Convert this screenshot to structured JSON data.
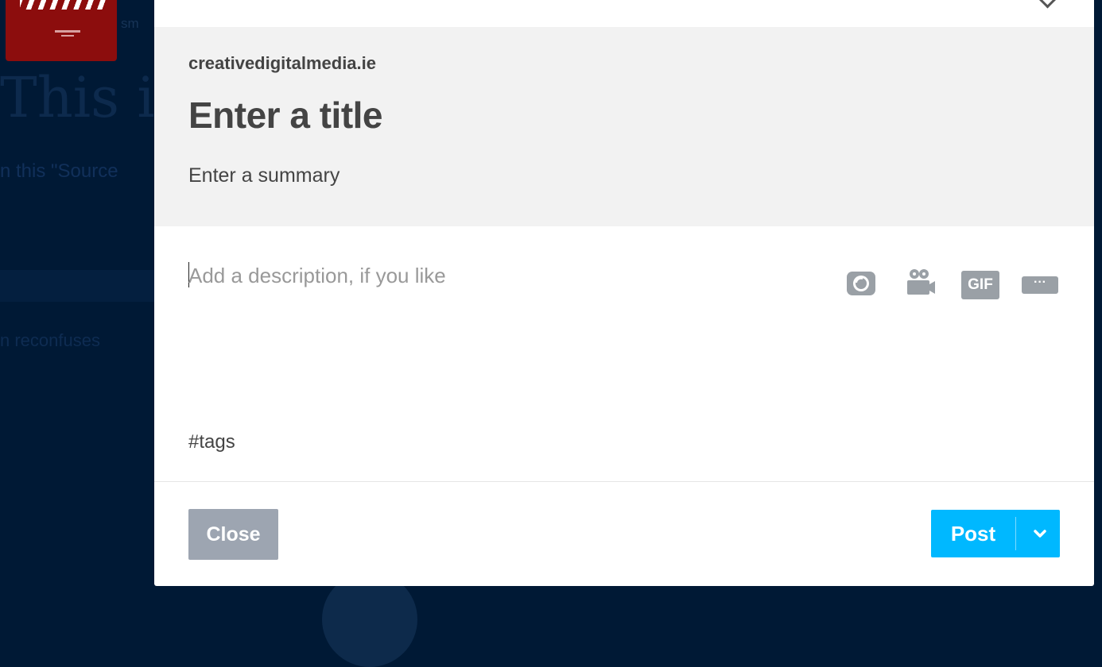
{
  "background": {
    "headline": "This is",
    "subline": "n this \"Source",
    "small_text": "sm",
    "line": "n reconfuses"
  },
  "modal": {
    "link": {
      "domain": "creativedigitalmedia.ie",
      "title_placeholder": "Enter a title",
      "summary_placeholder": "Enter a summary"
    },
    "description_placeholder": "Add a description, if you like",
    "toolbar": {
      "gif_label": "GIF",
      "more_label": "···",
      "icons": [
        "camera-icon",
        "video-camera-icon",
        "gif-icon",
        "more-icon"
      ]
    },
    "tags_placeholder": "#tags",
    "footer": {
      "close_label": "Close",
      "post_label": "Post"
    }
  },
  "colors": {
    "backdrop": "#001935",
    "post_button": "#00b8ff",
    "close_button": "#9da5b1",
    "link_block": "#f2f2f2"
  }
}
